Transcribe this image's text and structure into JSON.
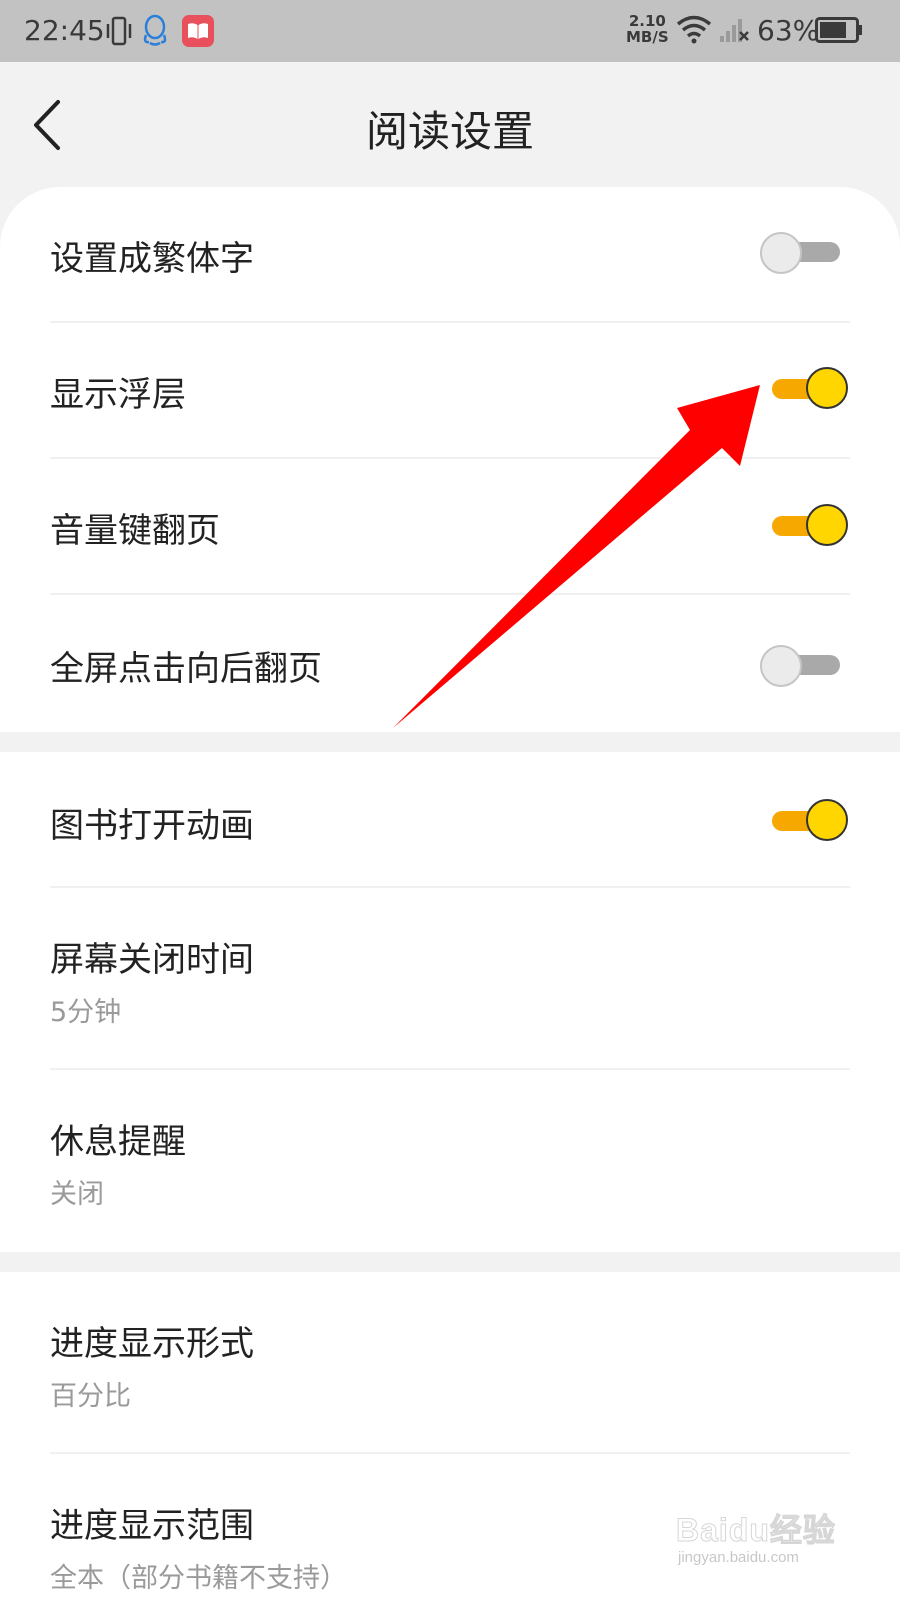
{
  "status_bar": {
    "time": "22:45",
    "speed_value": "2.10",
    "speed_unit": "MB/S",
    "battery_percent": "63%",
    "icons": [
      "vibrate-icon",
      "qq-icon",
      "app-icon",
      "wifi-icon",
      "signal-icon",
      "battery-icon"
    ]
  },
  "header": {
    "title": "阅读设置",
    "back_icon": "chevron-left-icon"
  },
  "settings": {
    "group1": [
      {
        "label": "设置成繁体字",
        "toggle": false
      },
      {
        "label": "显示浮层",
        "toggle": true
      },
      {
        "label": "音量键翻页",
        "toggle": true
      },
      {
        "label": "全屏点击向后翻页",
        "toggle": false
      }
    ],
    "group2": [
      {
        "label": "图书打开动画",
        "toggle": true
      },
      {
        "label": "屏幕关闭时间",
        "value": "5分钟"
      },
      {
        "label": "休息提醒",
        "value": "关闭"
      }
    ],
    "group3": [
      {
        "label": "进度显示形式",
        "value": "百分比"
      },
      {
        "label": "进度显示范围",
        "value": "全本（部分书籍不支持）"
      }
    ]
  },
  "colors": {
    "toggle_on_track": "#f7a800",
    "toggle_on_knob": "#ffd600",
    "toggle_off_track": "#a9a9a9",
    "annotation_arrow": "#ff0000"
  },
  "watermark": {
    "brand": "Baidu经验",
    "url": "jingyan.baidu.com"
  }
}
